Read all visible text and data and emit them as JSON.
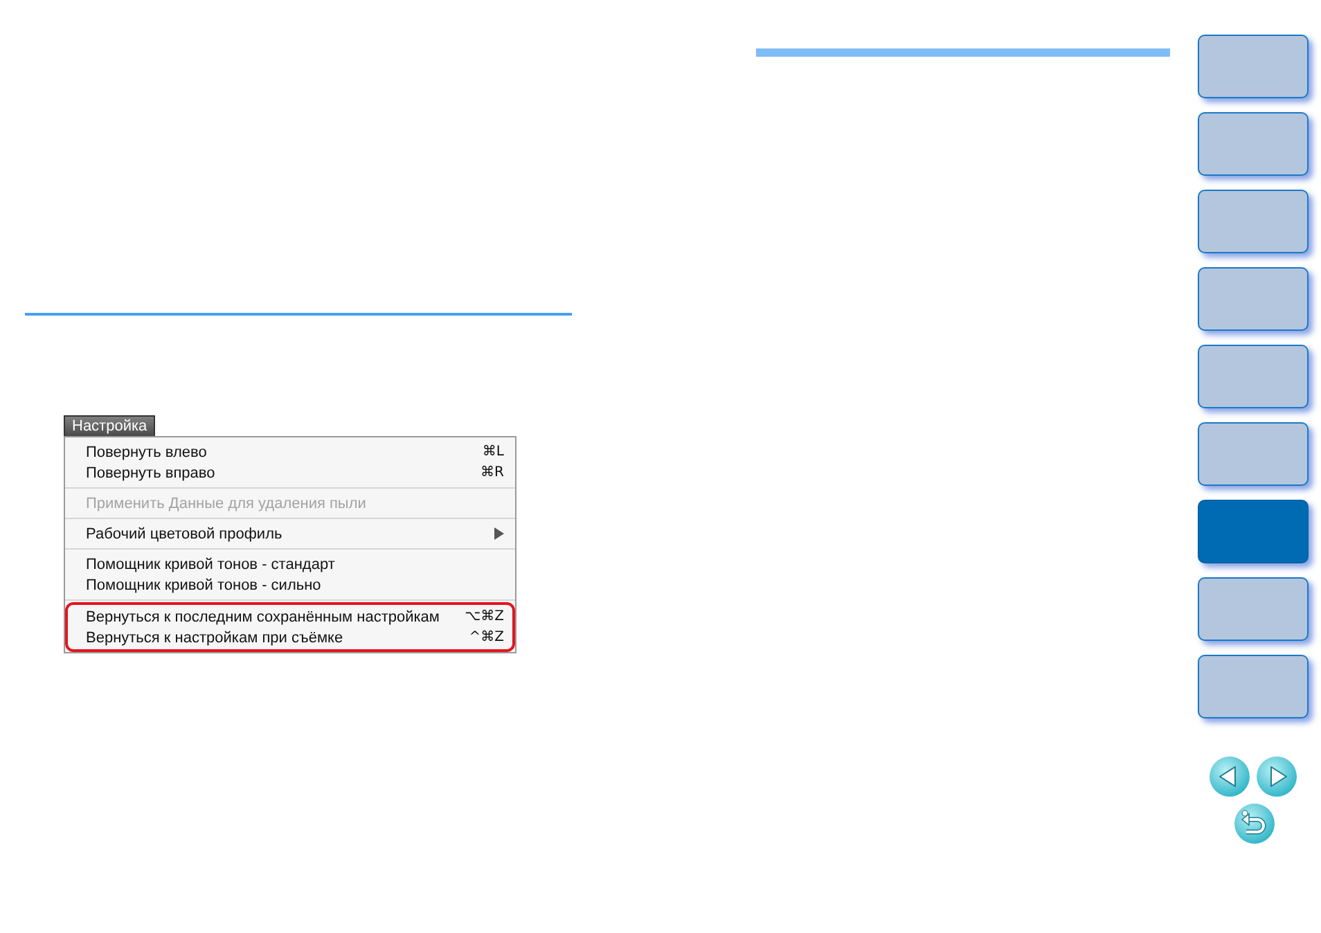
{
  "menu": {
    "title": "Настройка",
    "sections": [
      {
        "highlighted": false,
        "items": [
          {
            "label": "Повернуть влево",
            "shortcut": "⌘L",
            "disabled": false,
            "submenu": false
          },
          {
            "label": "Повернуть вправо",
            "shortcut": "⌘R",
            "disabled": false,
            "submenu": false
          }
        ]
      },
      {
        "highlighted": false,
        "items": [
          {
            "label": "Применить Данные для удаления пыли",
            "disabled": true,
            "submenu": false
          }
        ]
      },
      {
        "highlighted": false,
        "items": [
          {
            "label": "Рабочий цветовой профиль",
            "disabled": false,
            "submenu": true
          }
        ]
      },
      {
        "highlighted": false,
        "items": [
          {
            "label": "Помощник кривой тонов - стандарт",
            "disabled": false,
            "submenu": false
          },
          {
            "label": "Помощник кривой тонов - сильно",
            "disabled": false,
            "submenu": false
          }
        ]
      },
      {
        "highlighted": true,
        "items": [
          {
            "label": "Вернуться к последним сохранённым настройкам",
            "shortcut": "⌥⌘Z",
            "disabled": false,
            "submenu": false
          },
          {
            "label": "Вернуться к настройкам при съёмке",
            "shortcut": "^⌘Z",
            "disabled": false,
            "submenu": false
          }
        ]
      }
    ]
  },
  "side_tabs": [
    {
      "selected": false
    },
    {
      "selected": false
    },
    {
      "selected": false
    },
    {
      "selected": false
    },
    {
      "selected": false
    },
    {
      "selected": false
    },
    {
      "selected": true
    },
    {
      "selected": false
    },
    {
      "selected": false
    }
  ]
}
